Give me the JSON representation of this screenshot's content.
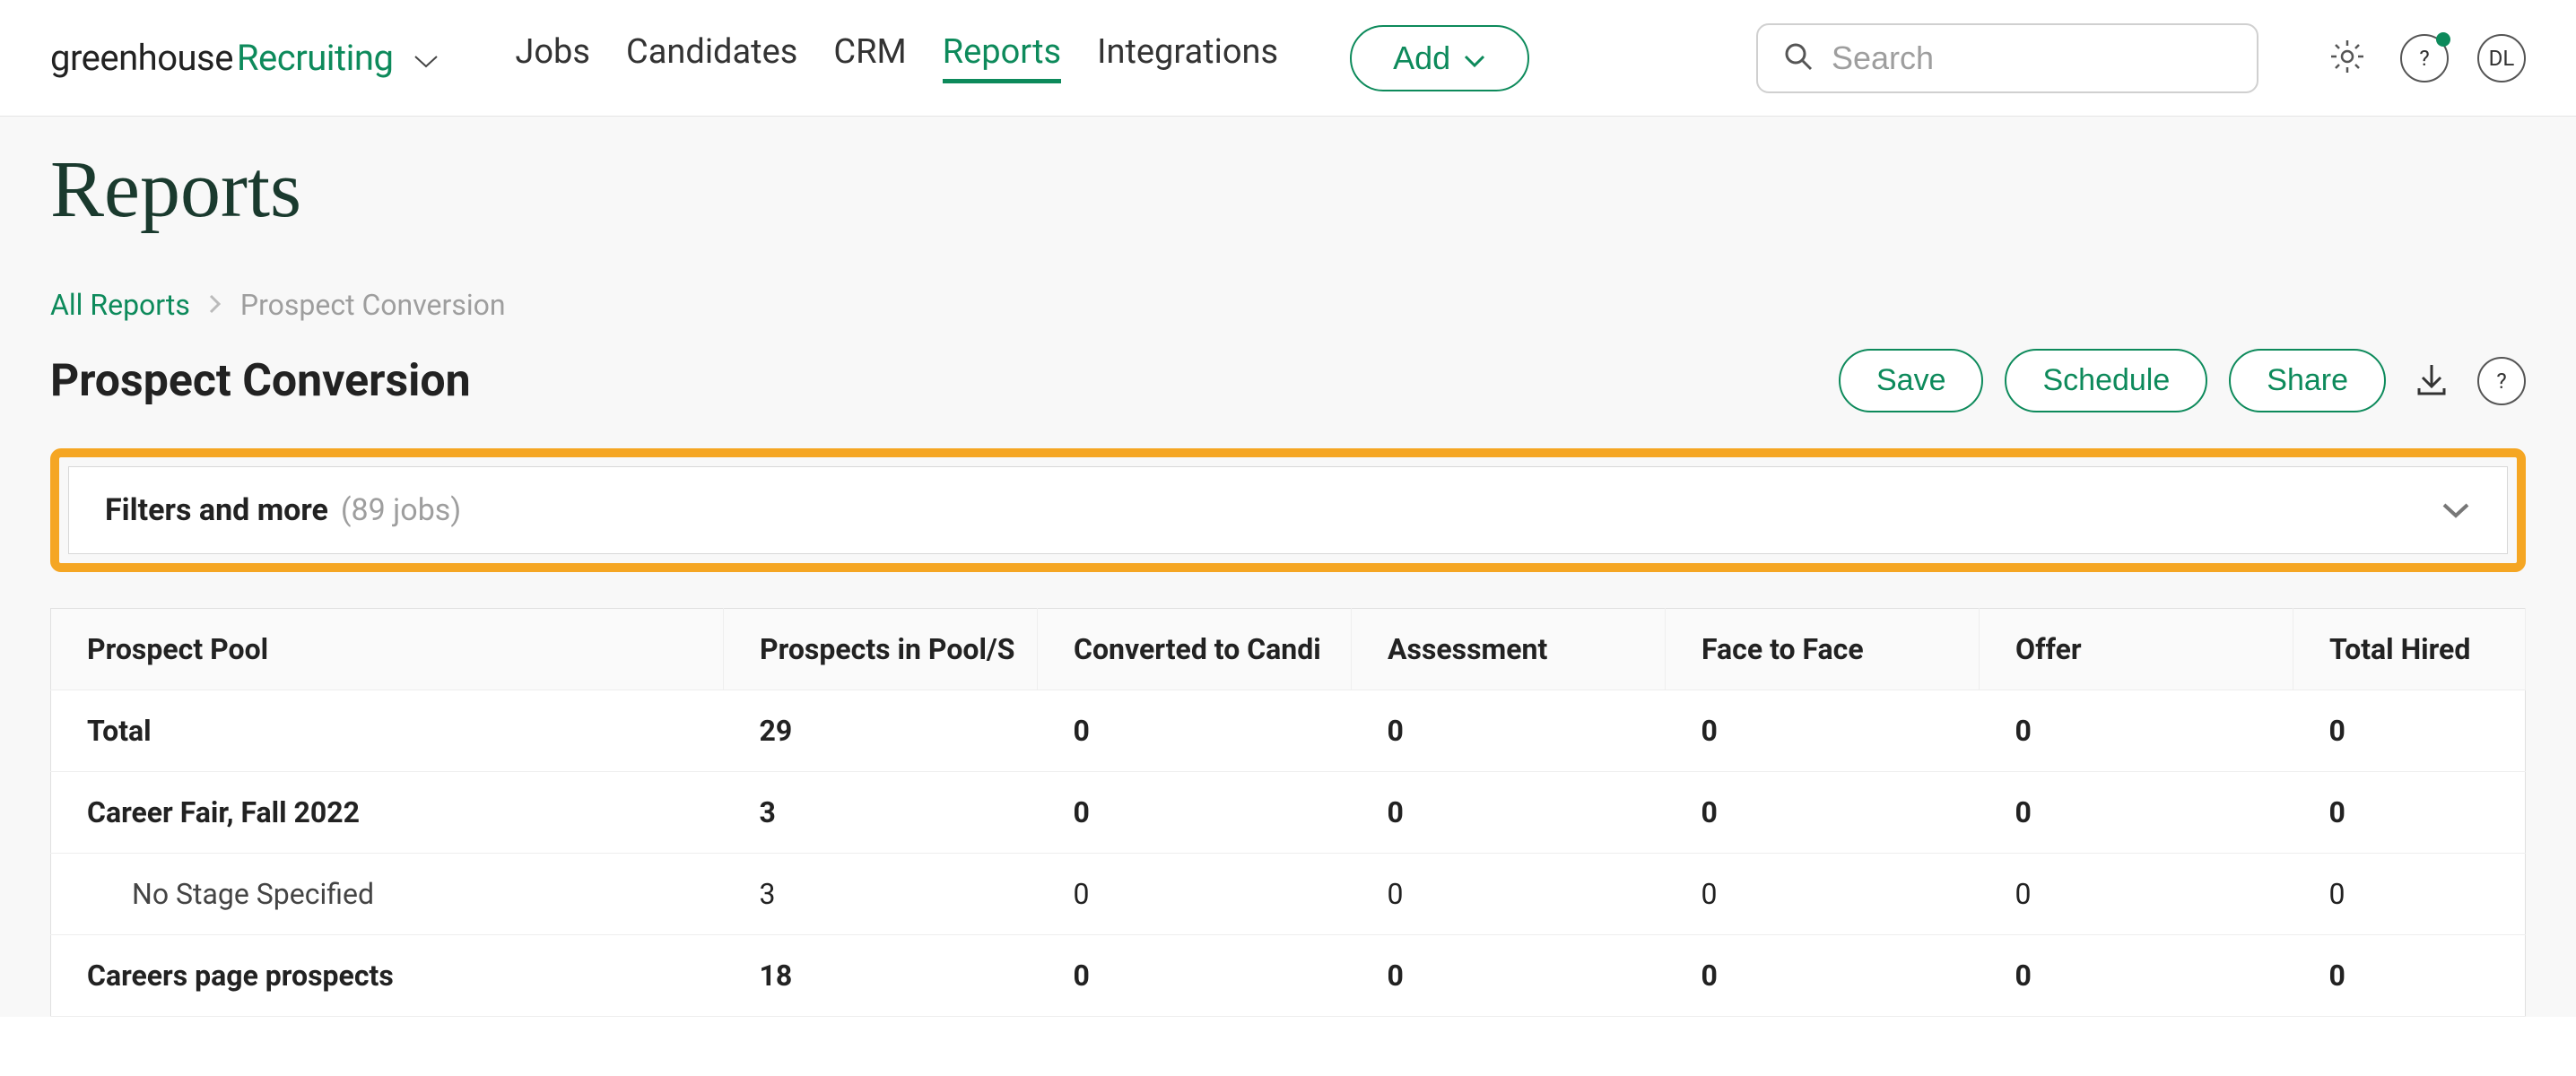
{
  "brand": {
    "part1": "greenhouse",
    "part2": "Recruiting"
  },
  "nav": {
    "items": [
      {
        "label": "Jobs"
      },
      {
        "label": "Candidates"
      },
      {
        "label": "CRM"
      },
      {
        "label": "Reports",
        "active": true
      },
      {
        "label": "Integrations"
      }
    ],
    "add_label": "Add"
  },
  "search": {
    "placeholder": "Search"
  },
  "user": {
    "initials": "DL",
    "help_glyph": "?"
  },
  "page": {
    "title": "Reports",
    "breadcrumb_root": "All Reports",
    "breadcrumb_current": "Prospect Conversion",
    "subtitle": "Prospect Conversion"
  },
  "actions": {
    "save": "Save",
    "schedule": "Schedule",
    "share": "Share"
  },
  "filters": {
    "label": "Filters and more",
    "count_text": "(89 jobs)"
  },
  "table": {
    "headers": [
      "Prospect Pool",
      "Prospects in Pool/S",
      "Converted to Candi",
      "Assessment",
      "Face to Face",
      "Offer",
      "Total Hired"
    ],
    "rows": [
      {
        "label": "Total",
        "bold": true,
        "vals": [
          "29",
          "0",
          "0",
          "0",
          "0",
          "0"
        ]
      },
      {
        "label": "Career Fair, Fall 2022",
        "bold": true,
        "vals": [
          "3",
          "0",
          "0",
          "0",
          "0",
          "0"
        ]
      },
      {
        "label": "No Stage Specified",
        "indent": true,
        "vals": [
          "3",
          "0",
          "0",
          "0",
          "0",
          "0"
        ]
      },
      {
        "label": "Careers page prospects",
        "bold": true,
        "vals": [
          "18",
          "0",
          "0",
          "0",
          "0",
          "0"
        ]
      }
    ]
  },
  "chart_data": {
    "type": "table",
    "title": "Prospect Conversion",
    "columns": [
      "Prospect Pool",
      "Prospects in Pool/Stage",
      "Converted to Candidate",
      "Assessment",
      "Face to Face",
      "Offer",
      "Total Hired"
    ],
    "rows": [
      [
        "Total",
        29,
        0,
        0,
        0,
        0,
        0
      ],
      [
        "Career Fair, Fall 2022",
        3,
        0,
        0,
        0,
        0,
        0
      ],
      [
        "Career Fair, Fall 2022 / No Stage Specified",
        3,
        0,
        0,
        0,
        0,
        0
      ],
      [
        "Careers page prospects",
        18,
        0,
        0,
        0,
        0,
        0
      ]
    ]
  }
}
